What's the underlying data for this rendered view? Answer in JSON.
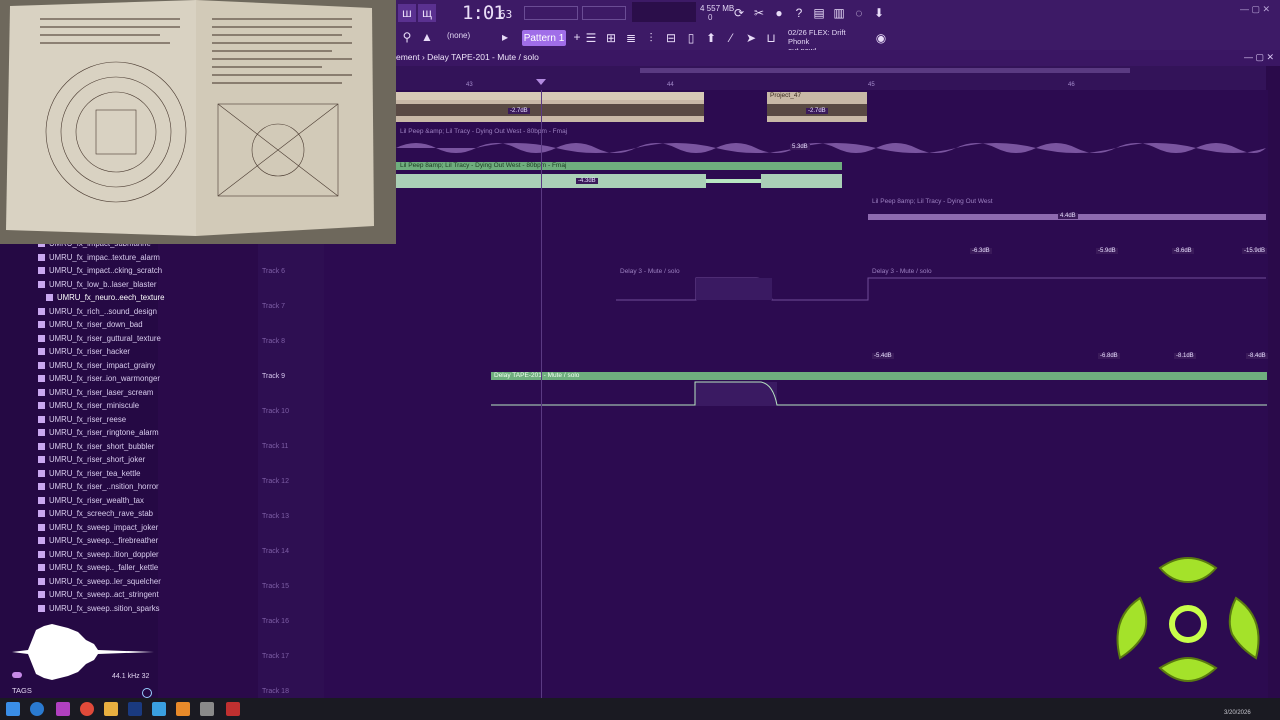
{
  "toolbar": {
    "time_main": "1:01",
    "time_small": "63",
    "pattern_label": "Pattern 1",
    "none_label": "(none)",
    "cpu_top": "4   557 MB",
    "cpu_bottom": "0",
    "news_line1": "02/26  FLEX: Drift Phonk",
    "news_line2": "out now!"
  },
  "playlist": {
    "title": "ement › Delay TAPE-201 - Mute / solo",
    "ruler_ticks": [
      "43",
      "44",
      "45",
      "46"
    ],
    "clips": {
      "project": "Project_47",
      "audio1": "Lil Peep &amp; Lil Tracy - Dying Out West - 80bpm - Fmaj",
      "audio2": "Lil Peep 8amp; Lil Tracy - Dying Out West - 80bpm - Fmaj",
      "audio3": "Lil Peep 8amp; Lil Tracy - Dying Out West",
      "delay1": "Delay 3 - Mute / solo",
      "delay2": "Delay 3 - Mute / solo",
      "delay_main": "Delay TAPE-201 - Mute / solo"
    },
    "volumes": {
      "v1": "-2.7dB",
      "v2": "-2.7dB",
      "v3": "5.3dB",
      "v4": "-4.3dB",
      "v5": "4.4dB",
      "v6": "-6.3dB",
      "v7": "-5.9dB",
      "v8": "-8.6dB",
      "v9": "-15.9dB",
      "v10": "-5.4dB",
      "v11": "-6.8dB",
      "v12": "-8.1dB",
      "v13": "-8.4dB"
    },
    "tracks": [
      "Track 6",
      "Track 7",
      "Track 8",
      "Track 9",
      "Track 10",
      "Track 11",
      "Track 12",
      "Track 13",
      "Track 14",
      "Track 15",
      "Track 16",
      "Track 17",
      "Track 18"
    ]
  },
  "browser": {
    "items": [
      "UMRU_fx_impact_submarine",
      "UMRU_fx_impac..texture_alarm",
      "UMRU_fx_impact..cking_scratch",
      "UMRU_fx_low_b..laser_blaster",
      "UMRU_fx_neuro..eech_texture",
      "UMRU_fx_rich_..sound_design",
      "UMRU_fx_riser_down_bad",
      "UMRU_fx_riser_guttural_texture",
      "UMRU_fx_riser_hacker",
      "UMRU_fx_riser_impact_grainy",
      "UMRU_fx_riser..ion_warmonger",
      "UMRU_fx_riser_laser_scream",
      "UMRU_fx_riser_miniscule",
      "UMRU_fx_riser_reese",
      "UMRU_fx_riser_ringtone_alarm",
      "UMRU_fx_riser_short_bubbler",
      "UMRU_fx_riser_short_joker",
      "UMRU_fx_riser_tea_kettle",
      "UMRU_fx_riser_..nsition_horror",
      "UMRU_fx_riser_wealth_tax",
      "UMRU_fx_screech_rave_stab",
      "UMRU_fx_sweep_impact_joker",
      "UMRU_fx_sweep.._firebreather",
      "UMRU_fx_sweep..ition_doppler",
      "UMRU_fx_sweep.._faller_kettle",
      "UMRU_fx_sweep..ler_squelcher",
      "UMRU_fx_sweep..act_stringent",
      "UMRU_fx_sweep..sition_sparks"
    ],
    "tags_label": "TAGS",
    "sample_info": "44.1 kHz 32"
  },
  "taskbar": {
    "clock": "3/20/2026"
  },
  "colors": {
    "accent": "#a06ee8",
    "green_clip": "#6fae7e",
    "background": "#2a0a4a"
  }
}
